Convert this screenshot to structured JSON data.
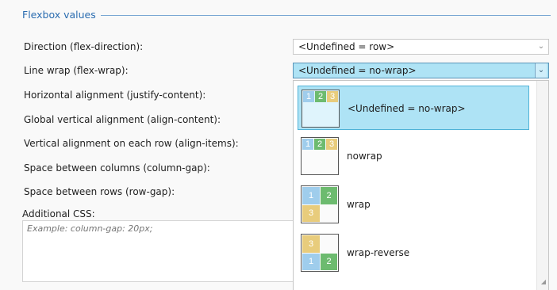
{
  "section": {
    "title": "Flexbox values"
  },
  "fields": {
    "direction": {
      "label": "Direction (flex-direction):",
      "value": "<Undefined = row>"
    },
    "wrap": {
      "label": "Line wrap (flex-wrap):",
      "value": "<Undefined = no-wrap>"
    },
    "justify": {
      "label": "Horizontal alignment (justify-content):"
    },
    "align_content": {
      "label": "Global vertical alignment (align-content):"
    },
    "align_items": {
      "label": "Vertical alignment on each row (align-items):"
    },
    "column_gap": {
      "label": "Space between columns (column-gap):"
    },
    "row_gap": {
      "label": "Space between rows (row-gap):"
    }
  },
  "css": {
    "label": "Additional CSS:",
    "placeholder": "Example: column-gap: 20px;"
  },
  "dropdown": {
    "options": [
      {
        "label": "<Undefined = no-wrap>",
        "selected": true,
        "boxes": [
          "1",
          "2",
          "3"
        ]
      },
      {
        "label": "nowrap",
        "selected": false,
        "boxes": [
          "1",
          "2",
          "3"
        ]
      },
      {
        "label": "wrap",
        "selected": false,
        "boxes": [
          "1",
          "2",
          "3"
        ]
      },
      {
        "label": "wrap-reverse",
        "selected": false,
        "boxes": [
          "3",
          "1",
          "2"
        ]
      }
    ]
  },
  "colors": {
    "accent": "#2a6cb0",
    "selected_bg": "#aee3f5",
    "box1": "#9fcdec",
    "box2": "#6dbb6f",
    "box3": "#e8cc7c"
  },
  "icons": {
    "chevron": "chevron-down-icon"
  }
}
